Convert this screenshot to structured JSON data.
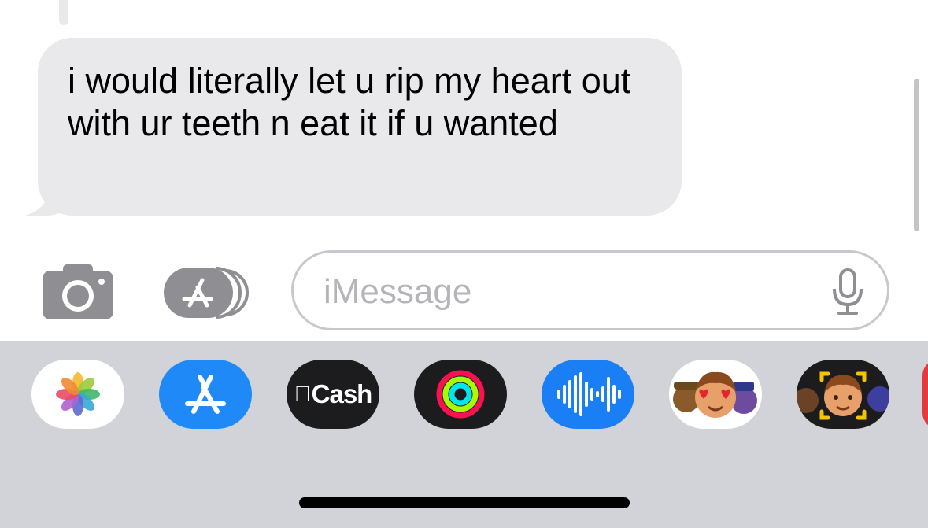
{
  "conversation": {
    "incoming_message": "i would literally let u rip my heart out with ur teeth n eat it if u wanted"
  },
  "compose": {
    "camera_icon": "camera-icon",
    "apps_icon": "app-store-icon",
    "placeholder": "iMessage",
    "value": "",
    "mic_icon": "microphone-icon"
  },
  "app_drawer": {
    "apps": [
      {
        "name": "Photos",
        "icon": "photos-icon",
        "background": "#ffffff"
      },
      {
        "name": "App Store",
        "icon": "app-store-icon",
        "background": "#1f8af7"
      },
      {
        "name": "Apple Cash",
        "icon": "apple-icon",
        "label": "Cash",
        "apple_glyph": "",
        "background": "#1c1c1e"
      },
      {
        "name": "Fitness",
        "icon": "activity-rings-icon",
        "background": "#1c1c1e"
      },
      {
        "name": "Audio Message",
        "icon": "waveform-icon",
        "background": "#1a7ff5"
      },
      {
        "name": "Memoji Stickers",
        "icon": "memoji-stickers-icon",
        "background": "#ffffff"
      },
      {
        "name": "Memoji",
        "icon": "memoji-camera-icon",
        "background": "#1c1c1e"
      }
    ]
  },
  "colors": {
    "incoming_bubble": "#e9e9eb",
    "drawer_background": "#d1d3d9",
    "placeholder_text": "#b4b4b9"
  }
}
